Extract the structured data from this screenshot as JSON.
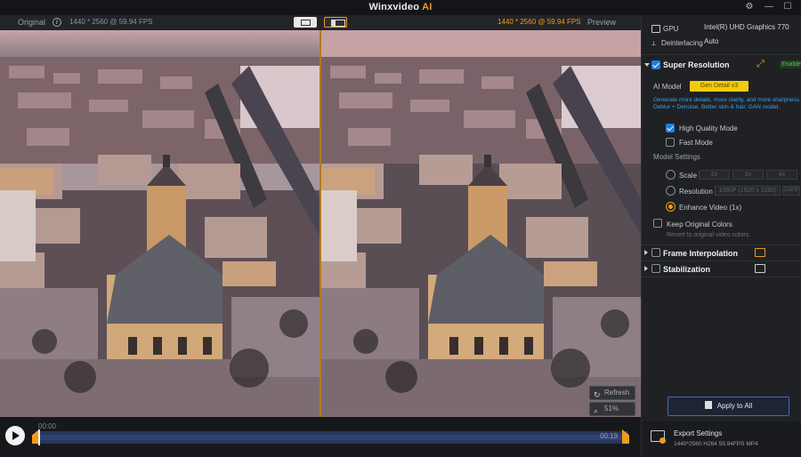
{
  "app": {
    "title": "Winxvideo",
    "title_ai": "AI"
  },
  "window_controls": {
    "settings": "⚙",
    "minimize": "—",
    "maximize": "☐"
  },
  "preview_header": {
    "original_label": "Original",
    "info_icon": "i",
    "resolution_left": "1440 * 2560 @ 59.94 FPS",
    "resolution_right": "1440 * 2560 @ 59.94 FPS",
    "preview_label": "Preview"
  },
  "preview_controls": {
    "refresh_label": "Refresh",
    "zoom_label": "51%"
  },
  "timeline": {
    "start_time": "00:00",
    "end_time": "00:19",
    "progress": 0
  },
  "panel": {
    "gpu_label": "GPU",
    "gpu_value": "Intel(R) UHD Graphics 770",
    "deinterlacing_label": "Deinterlacing",
    "deinterlacing_value": "Auto",
    "super_resolution": {
      "title": "Super Resolution",
      "enabled_badge": "Enabled",
      "ai_model_label": "AI Model",
      "ai_model_value": "Gen Detail v3",
      "description": "Generate more details, more clarity, and more sharpness. Deblur + Denoise. Better skin & hair. GAN model.",
      "high_quality_label": "High Quality Mode",
      "fast_mode_label": "Fast Mode",
      "model_settings_label": "Model Settings",
      "scale_label": "Scale",
      "scale_options": [
        "2x",
        "3x",
        "4x"
      ],
      "resolution_label": "Resolution",
      "resolution_options": [
        "1080P (1920 x 1080)",
        "2160P"
      ],
      "enhance_label": "Enhance Video (1x)",
      "keep_colors_label": "Keep Original Colors",
      "keep_colors_hint": "Revert to original video colors."
    },
    "frame_interpolation_title": "Frame Interpolation",
    "stabilization_title": "Stabilization",
    "apply_all_label": "Apply to All",
    "export": {
      "title": "Export Settings",
      "details": "1440*2560   H264   59.94FPS   MP4"
    }
  }
}
